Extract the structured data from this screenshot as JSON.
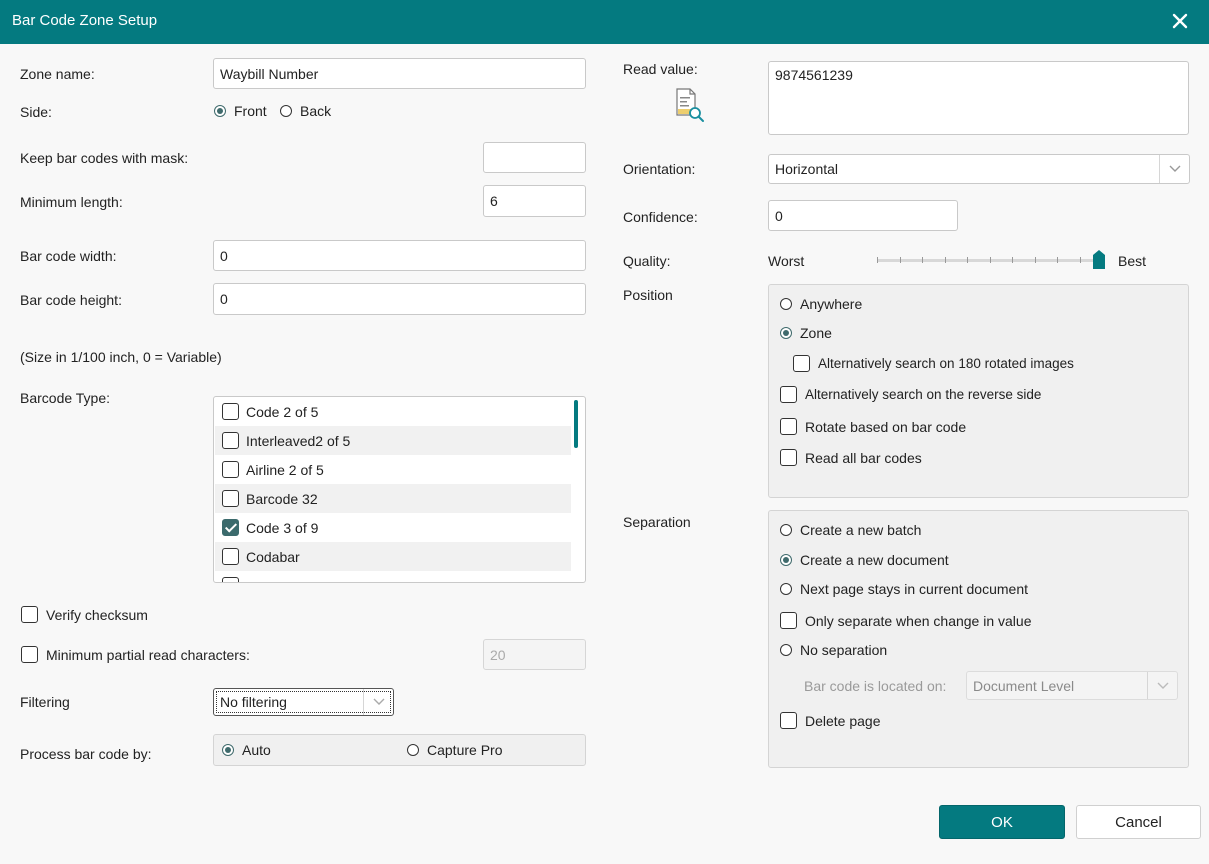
{
  "window": {
    "title": "Bar Code Zone Setup"
  },
  "left": {
    "zone_name": {
      "label": "Zone name:",
      "value": "Waybill Number"
    },
    "side": {
      "label": "Side:",
      "options": [
        "Front",
        "Back"
      ],
      "selected": "Front"
    },
    "keep_mask": {
      "label": "Keep bar codes with mask:",
      "value": ""
    },
    "min_length": {
      "label": "Minimum length:",
      "value": "6"
    },
    "bc_width": {
      "label": "Bar code width:",
      "value": "0"
    },
    "bc_height": {
      "label": "Bar code height:",
      "value": "0"
    },
    "size_note": "(Size in 1/100 inch, 0 = Variable)",
    "barcode_type": {
      "label": "Barcode Type:",
      "items": [
        {
          "label": "Code 2 of 5",
          "checked": false
        },
        {
          "label": "Interleaved2 of 5",
          "checked": false
        },
        {
          "label": "Airline 2 of 5",
          "checked": false
        },
        {
          "label": "Barcode 32",
          "checked": false
        },
        {
          "label": "Code 3 of 9",
          "checked": true
        },
        {
          "label": "Codabar",
          "checked": false
        }
      ]
    },
    "verify_checksum": {
      "label": "Verify checksum",
      "checked": false
    },
    "min_partial": {
      "label": "Minimum partial read characters:",
      "checked": false,
      "value": "20"
    },
    "filtering": {
      "label": "Filtering",
      "value": "No filtering"
    },
    "process_by": {
      "label": "Process bar code by:",
      "options": [
        "Auto",
        "Capture Pro"
      ],
      "selected": "Auto"
    }
  },
  "right": {
    "read_value": {
      "label": "Read value:",
      "value": "9874561239"
    },
    "orientation": {
      "label": "Orientation:",
      "value": "Horizontal"
    },
    "confidence": {
      "label": "Confidence:",
      "value": "0"
    },
    "quality": {
      "label": "Quality:",
      "min_label": "Worst",
      "max_label": "Best",
      "level": 1.0
    },
    "position": {
      "label": "Position",
      "anywhere": "Anywhere",
      "zone": "Zone",
      "selected": "Zone",
      "alt_180": {
        "label": "Alternatively search on 180 rotated images",
        "checked": false
      },
      "alt_reverse": {
        "label": "Alternatively search on the reverse side",
        "checked": false
      },
      "rotate": {
        "label": "Rotate based on bar code",
        "checked": false
      },
      "read_all": {
        "label": "Read all bar codes",
        "checked": false
      }
    },
    "separation": {
      "label": "Separation",
      "new_batch": "Create a new batch",
      "new_document": "Create a new document",
      "next_page": "Next page stays in current document",
      "no_separation": "No separation",
      "selected": "Create a new document",
      "only_change": {
        "label": "Only separate when change in value",
        "checked": false
      },
      "located_on": {
        "label": "Bar code is located on:",
        "value": "Document Level"
      },
      "delete_page": {
        "label": "Delete page",
        "checked": false
      }
    }
  },
  "buttons": {
    "ok": "OK",
    "cancel": "Cancel"
  },
  "colors": {
    "accent": "#047a80"
  }
}
